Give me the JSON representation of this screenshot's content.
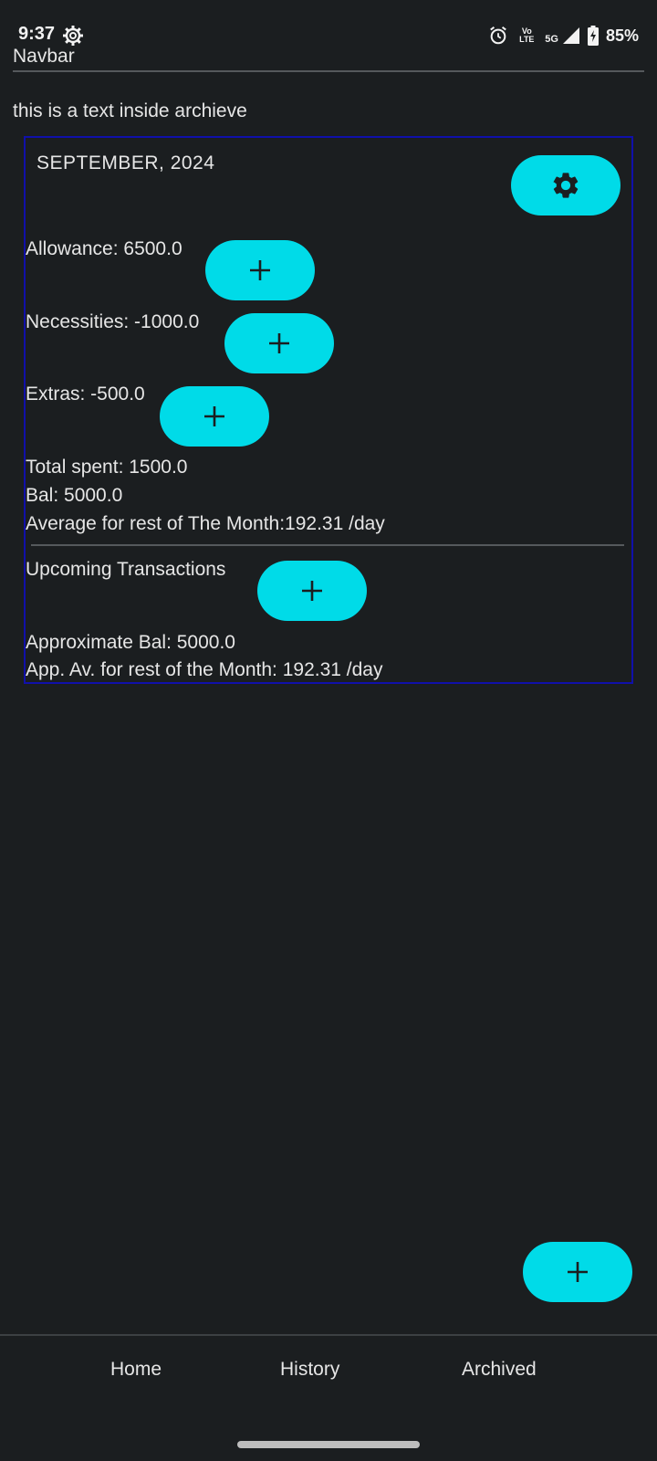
{
  "status_bar": {
    "time": "9:37",
    "network_volte": "Vo LTE",
    "network_5g": "5G",
    "battery": "85%"
  },
  "navbar": {
    "title": "Navbar"
  },
  "intro_text": "this is a text inside archieve",
  "month_card": {
    "title": "SEPTEMBER, 2024",
    "allowance": "Allowance: 6500.0",
    "necessities": "Necessities: -1000.0",
    "extras": "Extras: -500.0",
    "total_spent": "Total spent: 1500.0",
    "balance": "Bal: 5000.0",
    "average": "Average for rest of The Month:192.31 /day",
    "upcoming_label": "Upcoming Transactions",
    "approx_balance": "Approximate Bal: 5000.0",
    "approx_average": "App. Av. for rest of the Month: 192.31 /day"
  },
  "bottom_nav": {
    "items": [
      "Home",
      "History",
      "Archived"
    ]
  },
  "colors": {
    "background": "#1b1e20",
    "accent": "#00dbe8",
    "card_border": "#1010aa",
    "text": "#e6e6e6"
  }
}
